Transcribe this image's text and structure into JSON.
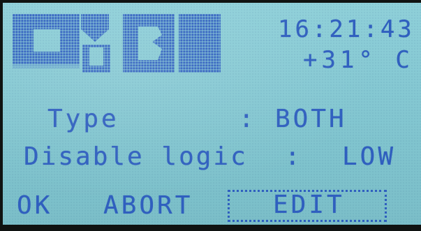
{
  "status": {
    "time": "16:21:43",
    "temperature": "+31° C"
  },
  "settings": [
    {
      "label": "Type",
      "separator": ":",
      "value": "BOTH"
    },
    {
      "label": "Disable logic",
      "separator": ":",
      "value": "LOW"
    }
  ],
  "softkeys": {
    "ok": "OK",
    "abort": "ABORT",
    "edit": "EDIT"
  },
  "colors": {
    "lcd_background": "#86c9d3",
    "pixel": "#2f5fbf"
  }
}
